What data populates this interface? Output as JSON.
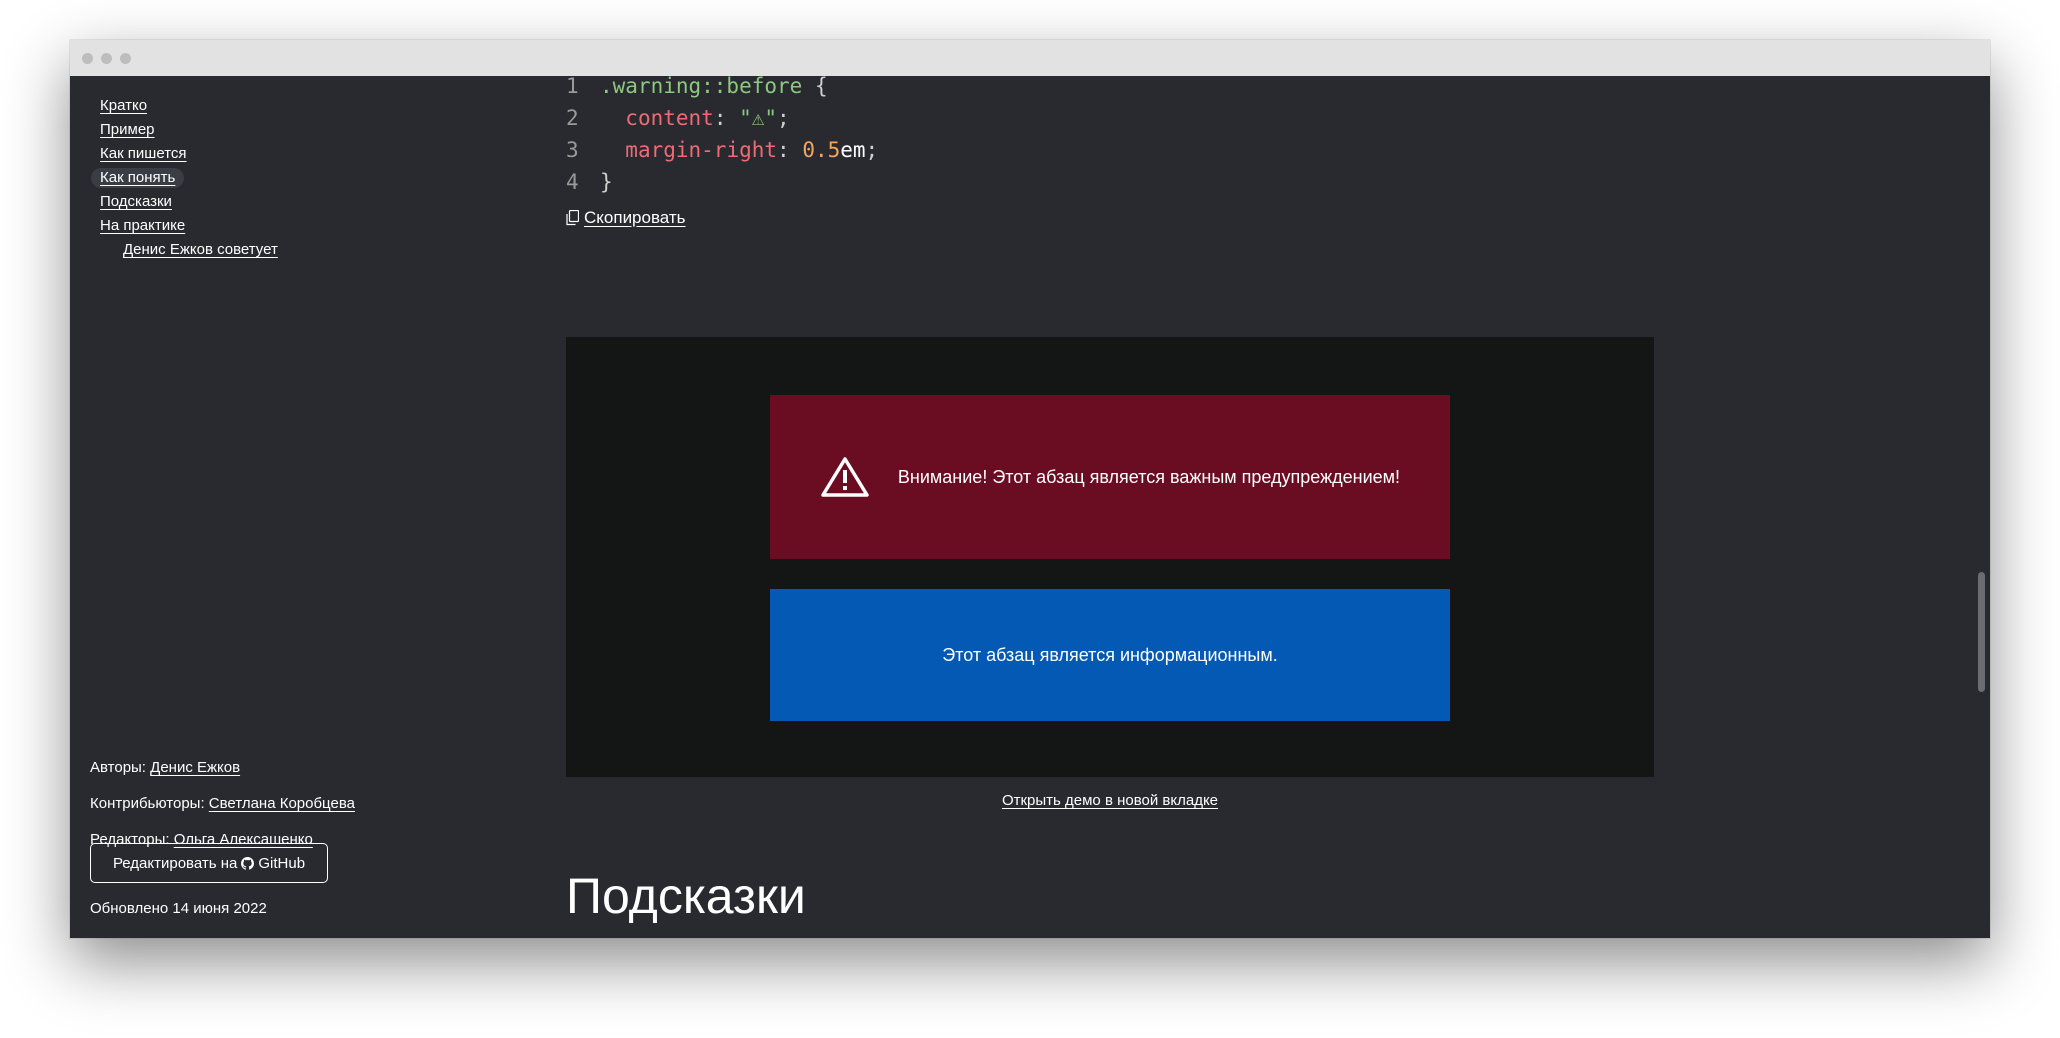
{
  "toc": {
    "items": [
      {
        "label": "Кратко"
      },
      {
        "label": "Пример"
      },
      {
        "label": "Как пишется"
      },
      {
        "label": "Как понять",
        "active": true
      },
      {
        "label": "Подсказки"
      },
      {
        "label": "На практике"
      },
      {
        "label": "Денис Ежков советует"
      }
    ]
  },
  "code": {
    "lines": [
      {
        "num": "1",
        "selector": ".warning::before",
        "brace": " {"
      },
      {
        "num": "2",
        "prop": "content",
        "value": "\"⚠\"",
        "end": ";"
      },
      {
        "num": "3",
        "prop": "margin-right",
        "number": "0.5",
        "unit": "em",
        "end": ";"
      },
      {
        "num": "4",
        "brace": "}"
      }
    ],
    "copy_label": "Скопировать"
  },
  "demo": {
    "warning_text": "Внимание! Этот абзац является важным предупреждением!",
    "info_text": "Этот абзац является информационным.",
    "open_link": "Открыть демо в новой вкладке",
    "colors": {
      "background": "#141616",
      "warning": "#6a0d22",
      "info": "#0359b3"
    }
  },
  "section_heading": "Подсказки",
  "meta": {
    "authors_label": "Авторы:",
    "authors": "Денис Ежков",
    "contributors_label": "Контрибьюторы:",
    "contributors": "Светлана Коробцева",
    "editors_label": "Редакторы:",
    "editors": "Ольга Алексашенко",
    "edit_button_prefix": "Редактировать на",
    "edit_button_brand": "GitHub",
    "updated": "Обновлено 14 июня 2022"
  }
}
